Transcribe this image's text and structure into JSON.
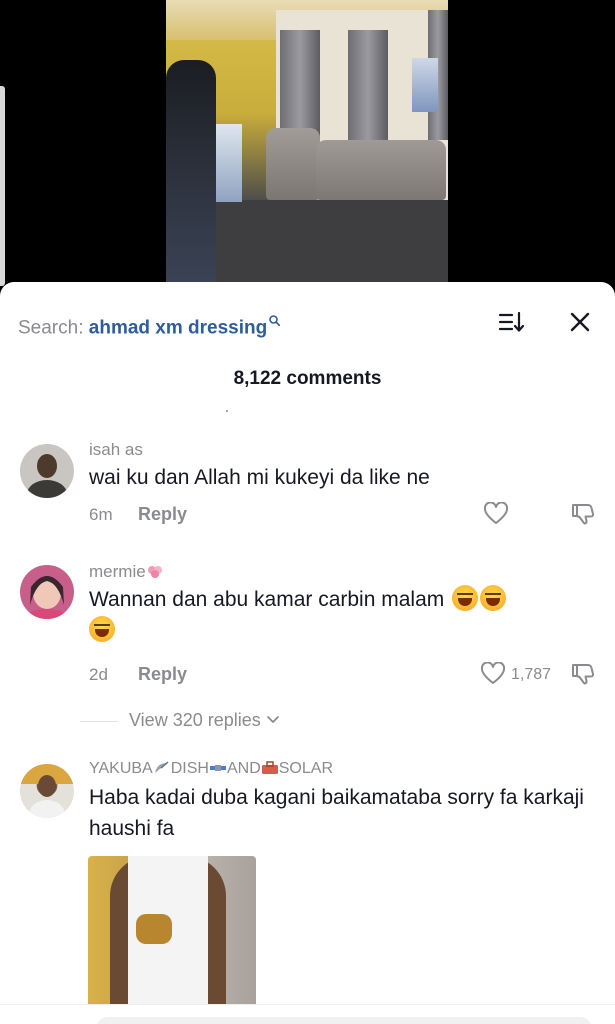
{
  "search": {
    "label": "Search:",
    "query": "ahmad xm dressing"
  },
  "comments_count": "8,122 comments",
  "comments": [
    {
      "username": "isah as",
      "text": "wai ku dan Allah mi kukeyi da like ne",
      "time": "6m",
      "reply_label": "Reply",
      "likes": ""
    },
    {
      "username": "mermie",
      "text": "Wannan dan abu kamar carbin malam",
      "time": "2d",
      "reply_label": "Reply",
      "likes": "1,787",
      "view_replies": "View 320 replies"
    },
    {
      "username_parts": [
        "YAKUBA",
        "DISH",
        "AND",
        "SOLAR"
      ],
      "text": "Haba kadai duba kagani baikamataba sorry fa karkaji haushi fa"
    }
  ],
  "colors": {
    "query_blue": "#2e5d9c",
    "text_primary": "#161823",
    "text_secondary": "#8a8b91"
  }
}
